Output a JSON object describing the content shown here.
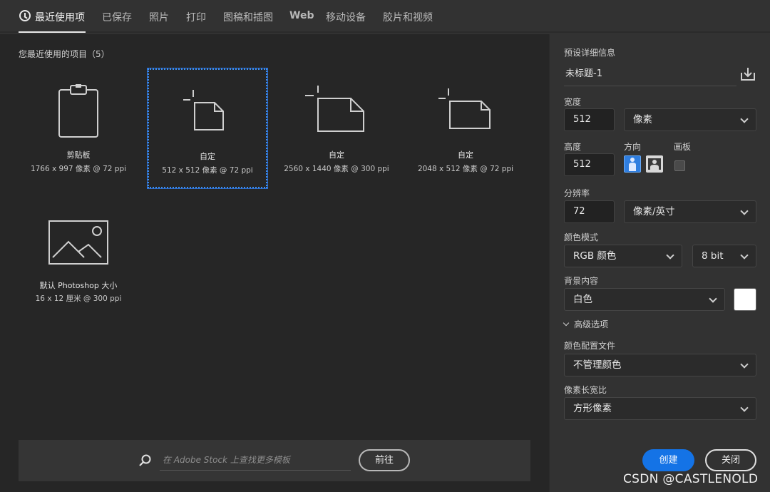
{
  "tabs": [
    {
      "label": "最近使用项"
    },
    {
      "label": "已保存"
    },
    {
      "label": "照片"
    },
    {
      "label": "打印"
    },
    {
      "label": "图稿和插图"
    },
    {
      "label": "Web"
    },
    {
      "label": "移动设备"
    },
    {
      "label": "胶片和视频"
    }
  ],
  "recent": {
    "title": "您最近使用的项目（5）",
    "items": [
      {
        "name": "剪贴板",
        "meta": "1766 x 997 像素 @ 72 ppi",
        "icon": "clipboard-icon"
      },
      {
        "name": "自定",
        "meta": "512 x 512 像素 @ 72 ppi",
        "icon": "new-document-icon"
      },
      {
        "name": "自定",
        "meta": "2560 x 1440 像素 @ 300 ppi",
        "icon": "new-document-icon"
      },
      {
        "name": "自定",
        "meta": "2048 x 512 像素 @ 72 ppi",
        "icon": "new-document-icon"
      },
      {
        "name": "默认 Photoshop 大小",
        "meta": "16 x 12 厘米 @ 300 ppi",
        "icon": "image-placeholder-icon"
      }
    ]
  },
  "search": {
    "placeholder": "在 Adobe Stock 上查找更多模板",
    "go_label": "前往"
  },
  "preset": {
    "section_label": "预设详细信息",
    "doc_name": "未标题-1",
    "width_label": "宽度",
    "width_value": "512",
    "width_unit": "像素",
    "height_label": "高度",
    "height_value": "512",
    "orientation_label": "方向",
    "artboard_label": "画板",
    "resolution_label": "分辨率",
    "resolution_value": "72",
    "resolution_unit": "像素/英寸",
    "color_mode_label": "颜色模式",
    "color_mode_value": "RGB 颜色",
    "bit_depth_value": "8 bit",
    "background_label": "背景内容",
    "background_value": "白色",
    "background_color": "#ffffff",
    "advanced_label": "高级选项",
    "color_profile_label": "颜色配置文件",
    "color_profile_value": "不管理颜色",
    "pixel_aspect_label": "像素长宽比",
    "pixel_aspect_value": "方形像素"
  },
  "actions": {
    "create_label": "创建",
    "close_label": "关闭"
  },
  "watermark": "CSDN @CASTLENOLD",
  "colors": {
    "accent": "#1473e6",
    "selection": "#3b8ef3"
  }
}
